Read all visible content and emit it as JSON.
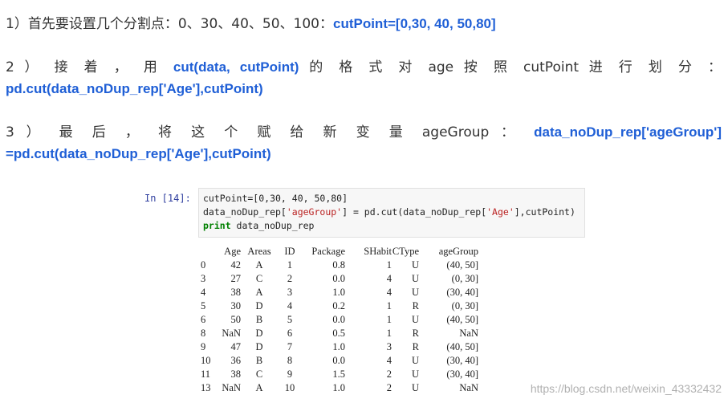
{
  "steps": [
    {
      "prefix": "1）首先要设置几个分割点：0、30、40、50、100：",
      "code": "cutPoint=[0,30, 40, 50,80]"
    },
    {
      "prefix": "2 ） 接 着 ， 用",
      "code1": "cut(data,  cutPoint)",
      "middle": "的 格 式 对  age  按 照  cutPoint  进 行 划 分 ：",
      "code2": "pd.cut(data_noDup_rep['Age'],cutPoint)"
    },
    {
      "prefix": "3 ） 最 后 ， 将 这 个 赋 给 新 变 量  ageGroup  ：",
      "code1": "data_noDup_rep['ageGroup']",
      "code2": "=pd.cut(data_noDup_rep['Age'],cutPoint)"
    }
  ],
  "notebook": {
    "prompt": "In [14]:",
    "code_line1": "cutPoint=[0,30, 40, 50,80]",
    "code_line2_a": "data_noDup_rep[",
    "code_line2_str1": "'ageGroup'",
    "code_line2_b": "] = pd.cut(data_noDup_rep[",
    "code_line2_str2": "'Age'",
    "code_line2_c": "],cutPoint)",
    "code_line3_kw": "print",
    "code_line3_rest": " data_noDup_rep",
    "output": {
      "columns": [
        "",
        "Age",
        "Areas",
        "ID",
        "Package",
        "SHabit",
        "CType",
        "ageGroup"
      ],
      "rows": [
        [
          "0",
          "42",
          "A",
          "1",
          "0.8",
          "1",
          "U",
          "(40, 50]"
        ],
        [
          "3",
          "27",
          "C",
          "2",
          "0.0",
          "4",
          "U",
          "(0, 30]"
        ],
        [
          "4",
          "38",
          "A",
          "3",
          "1.0",
          "4",
          "U",
          "(30, 40]"
        ],
        [
          "5",
          "30",
          "D",
          "4",
          "0.2",
          "1",
          "R",
          "(0, 30]"
        ],
        [
          "6",
          "50",
          "B",
          "5",
          "0.0",
          "1",
          "U",
          "(40, 50]"
        ],
        [
          "8",
          "NaN",
          "D",
          "6",
          "0.5",
          "1",
          "R",
          "NaN"
        ],
        [
          "9",
          "47",
          "D",
          "7",
          "1.0",
          "3",
          "R",
          "(40, 50]"
        ],
        [
          "10",
          "36",
          "B",
          "8",
          "0.0",
          "4",
          "U",
          "(30, 40]"
        ],
        [
          "11",
          "38",
          "C",
          "9",
          "1.5",
          "2",
          "U",
          "(30, 40]"
        ],
        [
          "13",
          "NaN",
          "A",
          "10",
          "1.0",
          "2",
          "U",
          "NaN"
        ]
      ]
    }
  },
  "watermark": "https://blog.csdn.net/weixin_43332432",
  "colors": {
    "code_blue": "#1f5fd6",
    "body_text": "#333333",
    "cell_bg": "#f7f7f7",
    "prompt_blue": "#303f9f"
  }
}
